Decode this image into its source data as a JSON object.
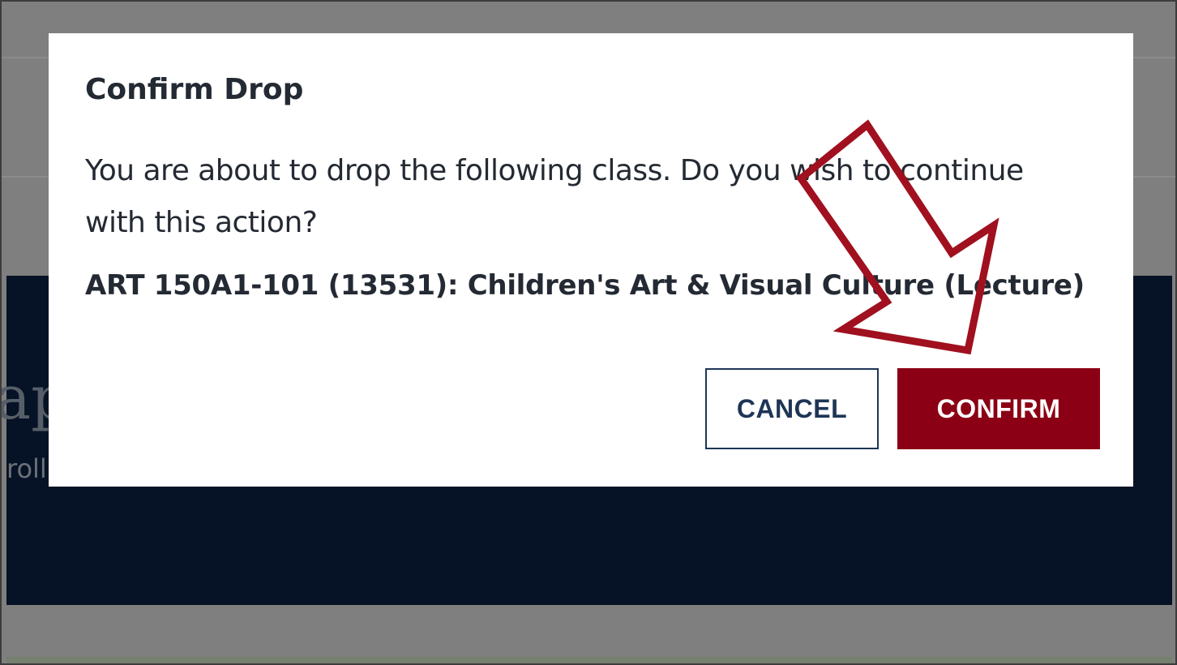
{
  "modal": {
    "title": "Confirm Drop",
    "body": "You are about to drop the following class. Do you wish to continue with this action?",
    "class_line": "ART 150A1-101 (13531): Children's Art & Visual Culture (Lecture)",
    "cancel_label": "CANCEL",
    "confirm_label": "CONFIRM"
  },
  "background": {
    "hero_title_fragment": "ap",
    "hero_subtitle_fragment": "roll"
  },
  "colors": {
    "overlay": "#7f7f7f",
    "hero": "#061225",
    "confirm_button": "#8b0014",
    "cancel_border": "#1e3556",
    "annotation_arrow": "#a0101f"
  },
  "annotation": {
    "arrow_icon": "arrow-down-right-icon"
  }
}
